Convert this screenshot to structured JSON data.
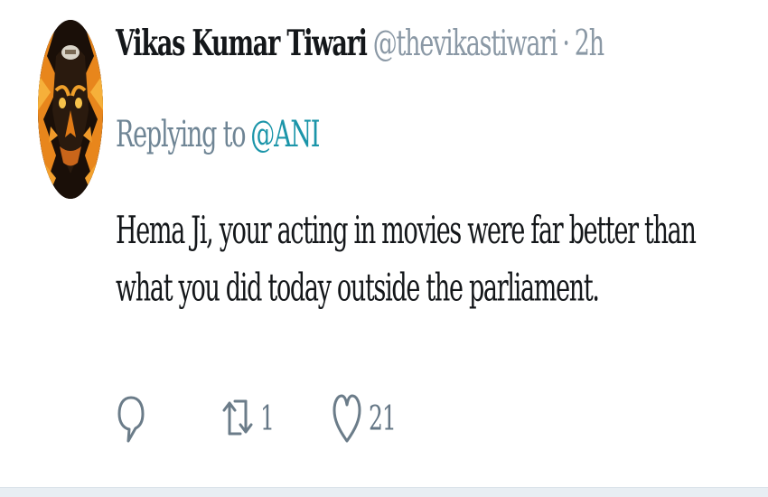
{
  "tweet": {
    "display_name": "Vikas Kumar Tiwari",
    "handle": "@thevikastiwari",
    "separator": "·",
    "timestamp": "2h",
    "replying_to_prefix": "Replying to",
    "replying_to_mention": "@ANI",
    "text": "Hema Ji, your acting in movies were far better than what you did today outside the parliament.",
    "retweet_count": "1",
    "like_count": "21"
  },
  "colors": {
    "handle_gray": "#8a98a5",
    "mention_teal": "#1b95a9",
    "icon_gray": "#6b7c89"
  },
  "icons": {
    "reply": "reply-bubble-icon",
    "retweet": "retweet-icon",
    "like": "heart-outline-icon"
  }
}
